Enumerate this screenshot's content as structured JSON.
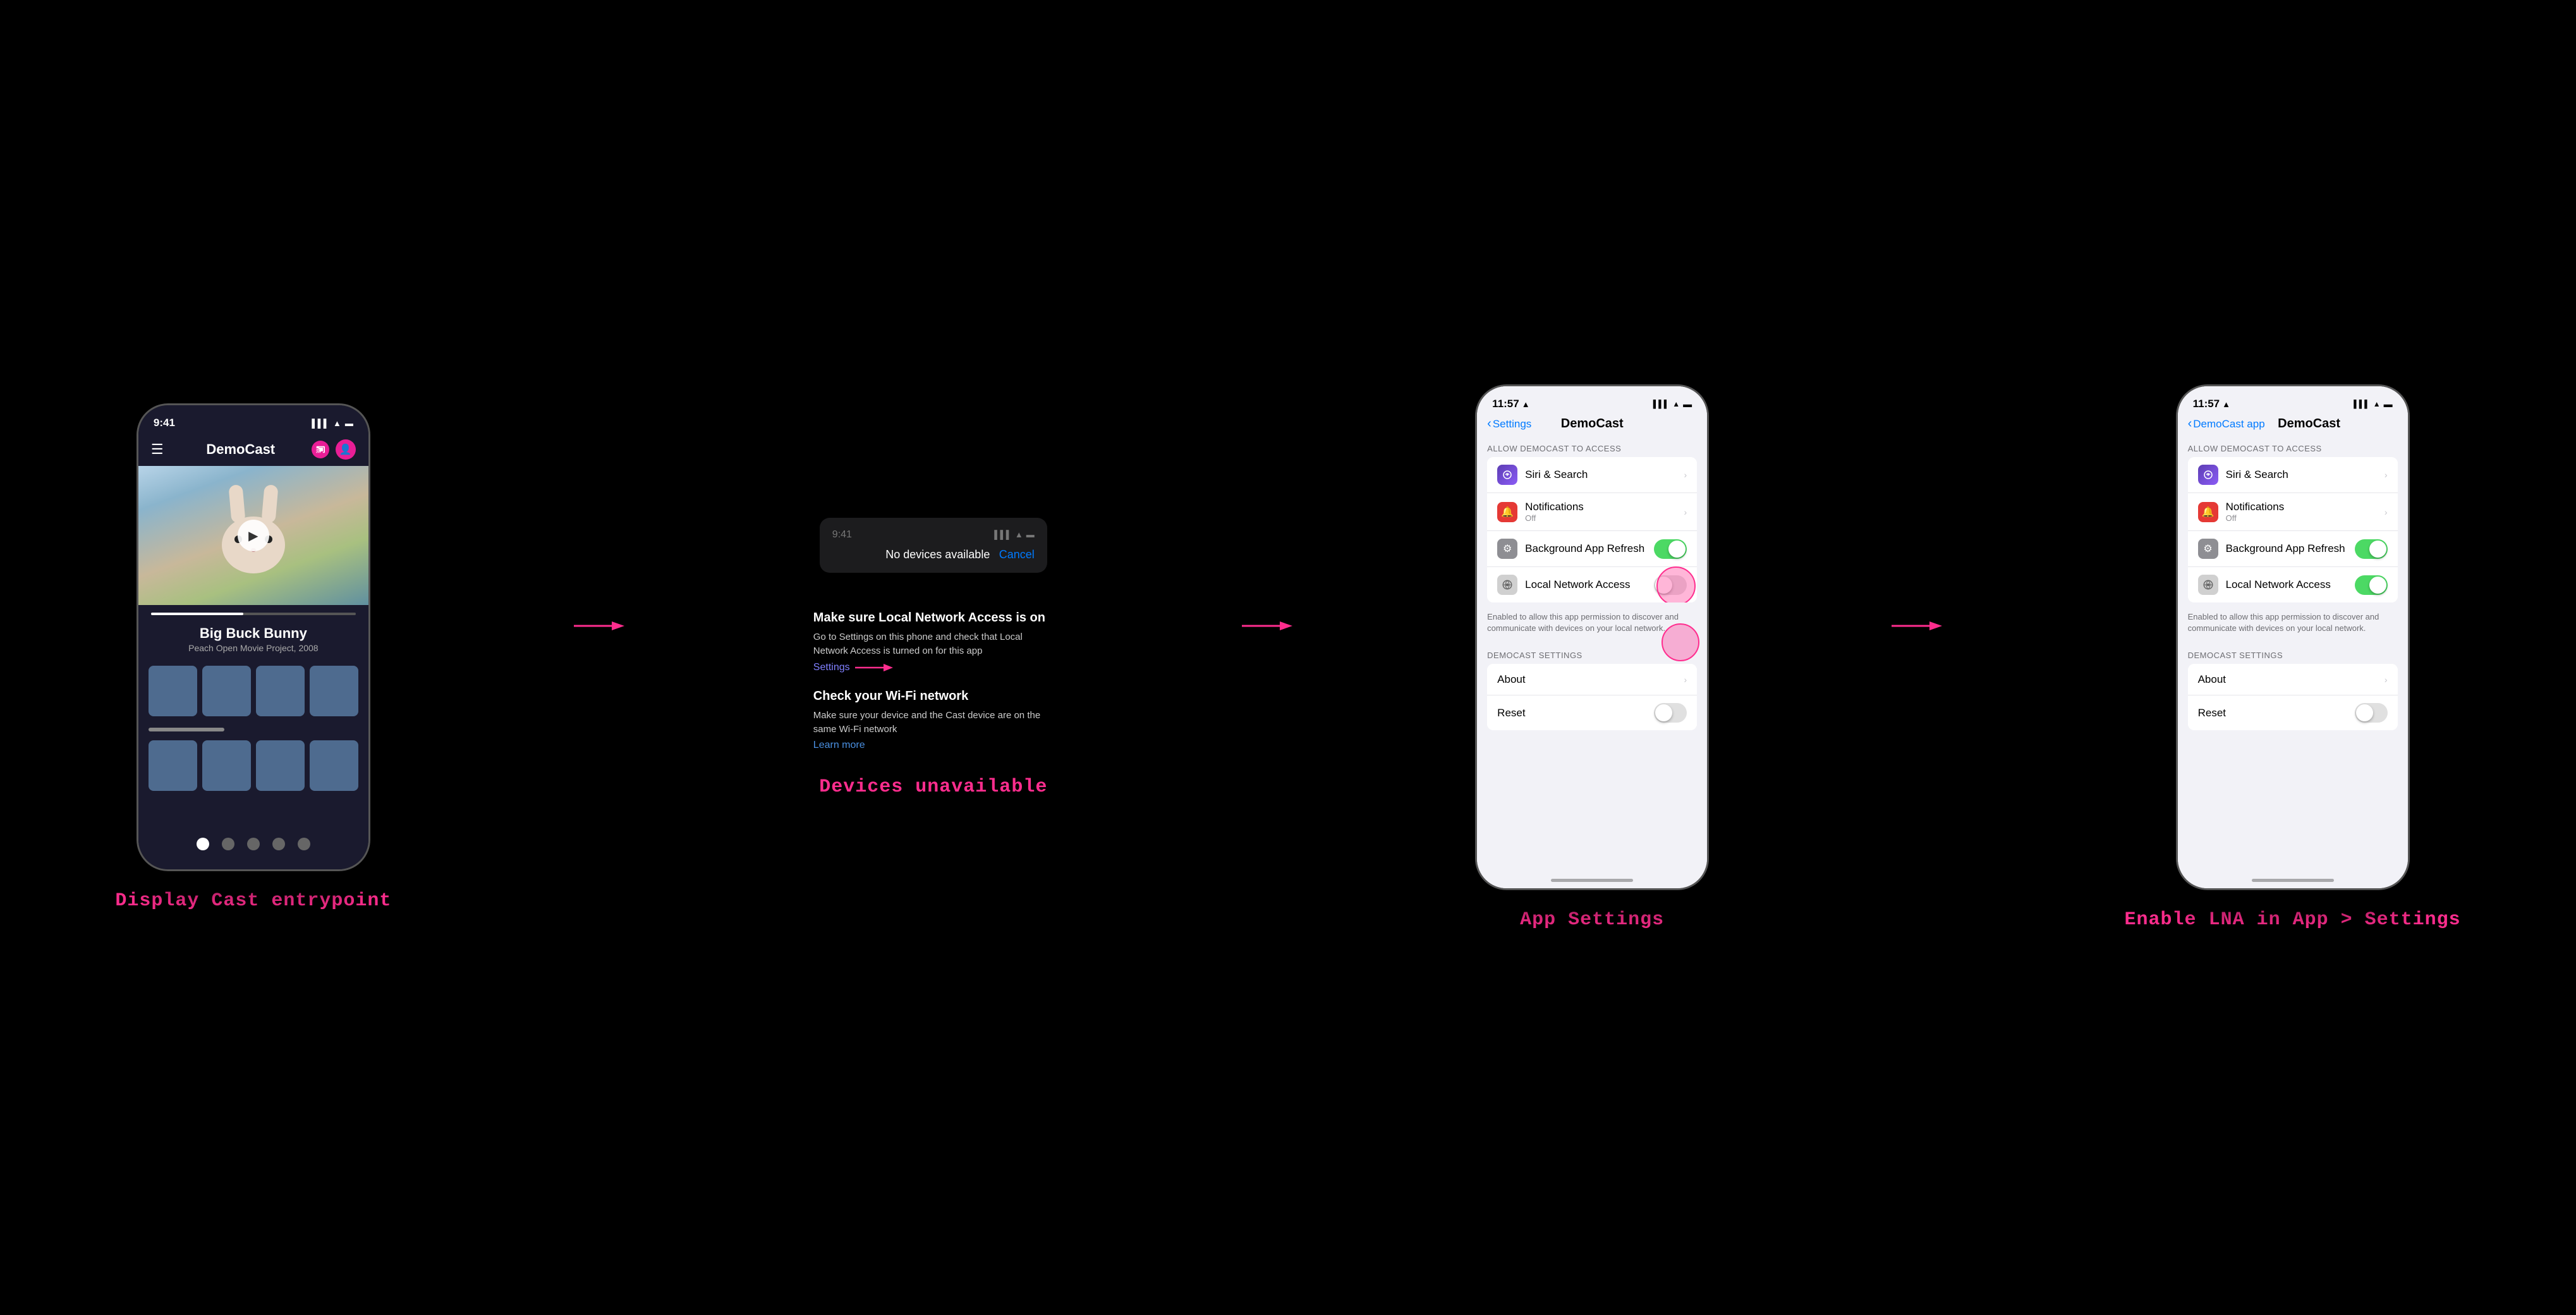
{
  "steps": [
    {
      "id": "step1",
      "label": "Display Cast entrypoint",
      "phone": {
        "status_time": "9:41",
        "app_title": "DemoCast",
        "movie_title": "Big Buck Bunny",
        "movie_subtitle": "Peach Open Movie Project, 2008"
      }
    },
    {
      "id": "step2",
      "label": "Devices unavailable",
      "popup": {
        "status_time": "9:41",
        "title": "No devices available",
        "cancel": "Cancel"
      },
      "instructions": {
        "heading1": "Make sure Local Network Access is on",
        "text1": "Go to Settings on this phone and check that Local Network Access is turned on for this app",
        "link1": "Settings",
        "heading2": "Check your Wi-Fi network",
        "text2": "Make sure your device and the Cast device are on the same Wi-Fi network",
        "link2": "Learn more"
      }
    },
    {
      "id": "step3",
      "label": "App Settings",
      "phone": {
        "status_time": "11:57",
        "back_label": "Settings",
        "nav_title": "DemoCast",
        "section_header": "ALLOW DEMOCAST TO ACCESS",
        "rows": [
          {
            "icon_class": "icon-siri",
            "icon_text": "✦",
            "title": "Siri & Search",
            "subtitle": "",
            "type": "chevron"
          },
          {
            "icon_class": "icon-notifications",
            "icon_text": "🔔",
            "title": "Notifications",
            "subtitle": "Off",
            "type": "chevron"
          },
          {
            "icon_class": "icon-gear",
            "icon_text": "⚙",
            "title": "Background App Refresh",
            "subtitle": "",
            "type": "toggle_on"
          },
          {
            "icon_class": "icon-local",
            "icon_text": "",
            "title": "Local Network Access",
            "subtitle": "",
            "type": "toggle_off"
          }
        ],
        "local_note": "Enabled to allow this app permission to discover and communicate with devices on your local network.",
        "democast_section": "DEMOCAST SETTINGS",
        "democast_rows": [
          {
            "title": "About",
            "type": "chevron"
          },
          {
            "title": "Reset",
            "type": "toggle_off"
          }
        ]
      }
    },
    {
      "id": "step4",
      "label": "Enable LNA in App > Settings",
      "phone": {
        "status_time": "11:57",
        "back_label": "DemoCast app",
        "nav_title": "DemoCast",
        "section_header": "ALLOW DEMOCAST TO ACCESS",
        "rows": [
          {
            "icon_class": "icon-siri",
            "icon_text": "✦",
            "title": "Siri & Search",
            "subtitle": "",
            "type": "chevron"
          },
          {
            "icon_class": "icon-notifications",
            "icon_text": "🔔",
            "title": "Notifications",
            "subtitle": "Off",
            "type": "chevron"
          },
          {
            "icon_class": "icon-gear",
            "icon_text": "⚙",
            "title": "Background App Refresh",
            "subtitle": "",
            "type": "toggle_on"
          },
          {
            "icon_class": "icon-local",
            "icon_text": "",
            "title": "Local Network Access",
            "subtitle": "",
            "type": "toggle_on"
          }
        ],
        "local_note": "Enabled to allow this app permission to discover and communicate with devices on your local network.",
        "democast_section": "DEMOCAST SETTINGS",
        "democast_rows": [
          {
            "title": "About",
            "type": "chevron"
          },
          {
            "title": "Reset",
            "type": "toggle_off"
          }
        ]
      }
    }
  ],
  "arrows": {
    "right": "→"
  }
}
